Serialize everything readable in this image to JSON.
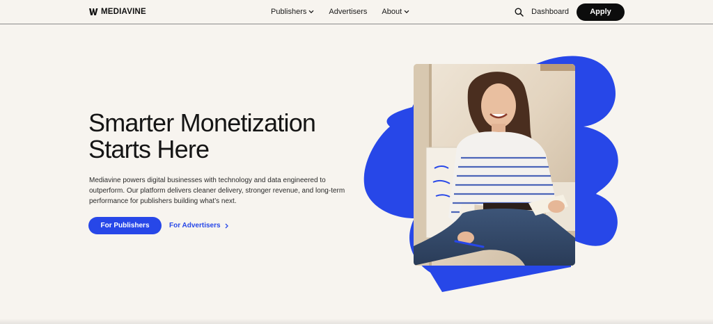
{
  "brand": {
    "name": "MEDIAVINE"
  },
  "nav": {
    "links": [
      {
        "label": "Publishers",
        "has_dropdown": true
      },
      {
        "label": "Advertisers",
        "has_dropdown": false
      },
      {
        "label": "About",
        "has_dropdown": true
      }
    ],
    "dashboard_label": "Dashboard",
    "apply_label": "Apply"
  },
  "hero": {
    "title_line1": "Smarter Monetization",
    "title_line2": "Starts Here",
    "desc_line1": "Mediavine powers digital businesses with technology and data engineered to",
    "desc_line2": "outperform. Our platform delivers cleaner delivery, stronger revenue, and long-term",
    "desc_line3": "performance for publishers building what’s next.",
    "primary_cta": "For Publishers",
    "secondary_cta": "For Advertisers"
  },
  "colors": {
    "background": "#f7f4ef",
    "accent_blue": "#2747e8",
    "apply_button": "#0c0c0c"
  },
  "icons": {
    "search": "search-icon",
    "chevron": "chevron-down-icon",
    "arrow": "chevron-right-icon"
  }
}
